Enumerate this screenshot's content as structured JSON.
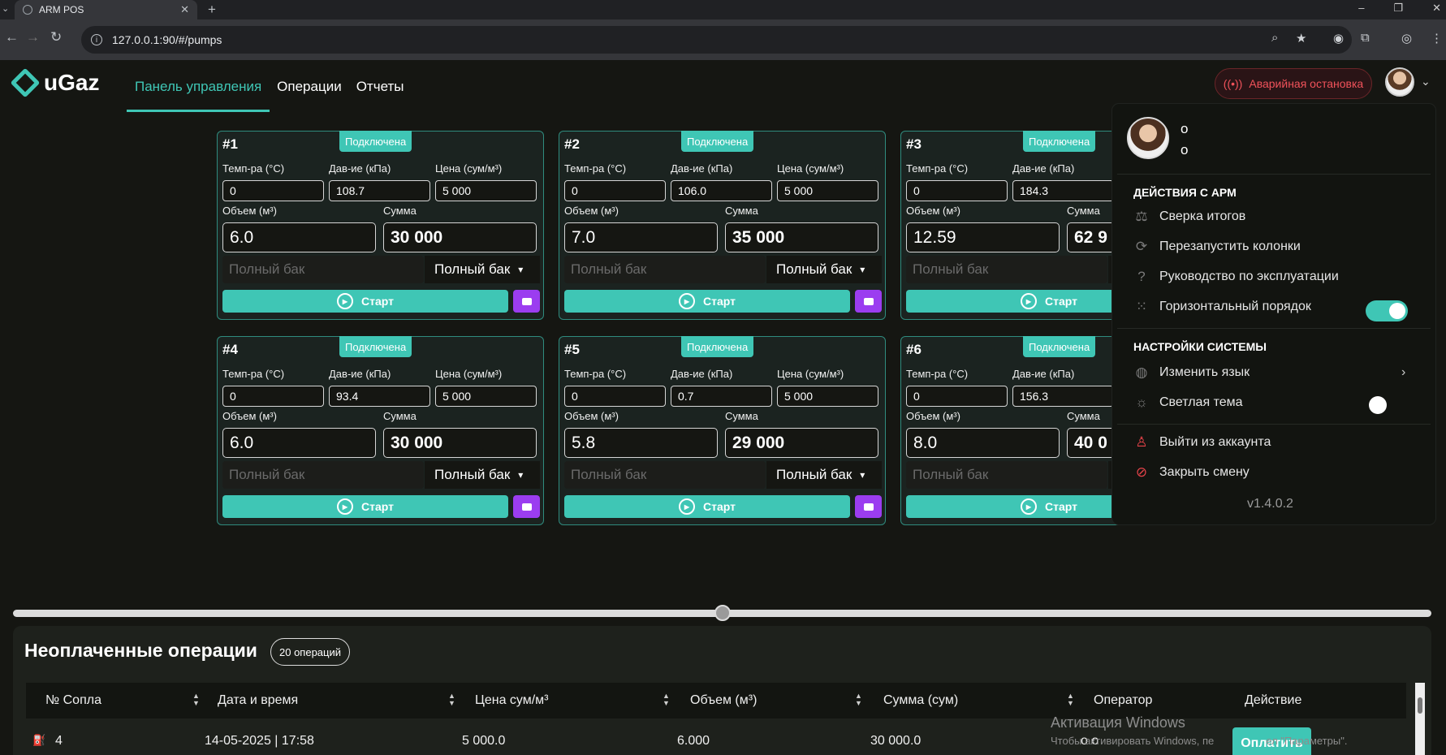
{
  "browser": {
    "tab_title": "ARM POS",
    "url": "127.0.0.1:90/#/pumps",
    "tab_list_icon": "chevron-down",
    "new_tab": "+",
    "close_tab": "✕"
  },
  "app": {
    "logo_text": "uGaz",
    "nav": [
      {
        "label": "Панель управления",
        "active": true
      },
      {
        "label": "Операции",
        "active": false
      },
      {
        "label": "Отчеты",
        "active": false
      }
    ],
    "emergency_label": "Аварийная остановка",
    "accent_color": "#3fc6b5",
    "danger_color": "#f0525a"
  },
  "pump_labels": {
    "temp": "Темп-ра (°C)",
    "pressure": "Дав-ие (кПа)",
    "price": "Цена (сум/м³)",
    "volume": "Объем (м³)",
    "sum": "Сумма",
    "full_tank_placeholder": "Полный бак",
    "full_tank_select": "Полный бак",
    "start": "Старт",
    "status": "Подключена"
  },
  "pumps": [
    {
      "title": "#1",
      "temp": "0",
      "pressure": "108.7",
      "price": "5 000",
      "volume": "6.0",
      "sum": "30 000"
    },
    {
      "title": "#2",
      "temp": "0",
      "pressure": "106.0",
      "price": "5 000",
      "volume": "7.0",
      "sum": "35 000"
    },
    {
      "title": "#3",
      "temp": "0",
      "pressure": "184.3",
      "price": "",
      "volume": "12.59",
      "sum": "62 9"
    },
    {
      "title": "#4",
      "temp": "0",
      "pressure": "93.4",
      "price": "5 000",
      "volume": "6.0",
      "sum": "30 000"
    },
    {
      "title": "#5",
      "temp": "0",
      "pressure": "0.7",
      "price": "5 000",
      "volume": "5.8",
      "sum": "29 000"
    },
    {
      "title": "#6",
      "temp": "0",
      "pressure": "156.3",
      "price": "",
      "volume": "8.0",
      "sum": "40 0"
    }
  ],
  "slider": {
    "value_fraction": 0.5
  },
  "ops": {
    "title": "Неоплаченные операции",
    "count": "20 операций",
    "columns": [
      "№ Сопла",
      "Дата и время",
      "Цена сум/м³",
      "Объем (м³)",
      "Сумма (сум)",
      "Оператор",
      "Действие"
    ],
    "rows": [
      {
        "nozzle": "4",
        "datetime": "14-05-2025 | 17:58",
        "price": "5 000.0",
        "volume": "6.000",
        "sum": "30 000.0",
        "operator": "o o",
        "action": "Оплатить"
      }
    ]
  },
  "watermark": {
    "line1": "Активация Windows",
    "line2": "Чтобы активировать Windows, пе",
    "line2_tail": "ел \"Параметры\"."
  },
  "menu": {
    "user_line1": "o",
    "user_line2": "o",
    "section1": "Действия с АРМ",
    "items1": [
      {
        "label": "Сверка итогов",
        "icon": "scale-icon"
      },
      {
        "label": "Перезапустить колонки",
        "icon": "restart-icon"
      },
      {
        "label": "Руководство по эксплуатации",
        "icon": "help-icon"
      },
      {
        "label": "Горизонтальный порядок",
        "icon": "grid-icon",
        "toggle": true
      }
    ],
    "section2": "Настройки системы",
    "items2": [
      {
        "label": "Изменить язык",
        "icon": "globe-icon"
      },
      {
        "label": "Светлая тема",
        "icon": "sun-icon",
        "toggle": false
      }
    ],
    "items3": [
      {
        "label": "Выйти из аккаунта",
        "icon": "user-icon"
      },
      {
        "label": "Закрыть смену",
        "icon": "block-icon"
      }
    ],
    "version": "v1.4.0.2"
  }
}
